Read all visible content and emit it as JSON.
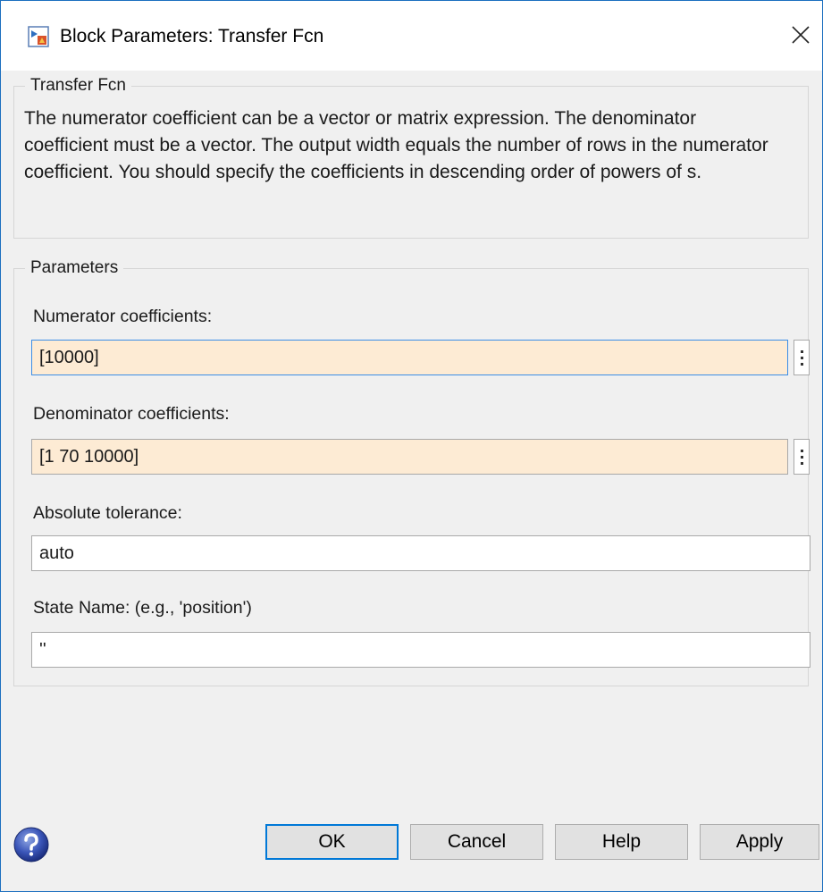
{
  "window": {
    "title": "Block Parameters: Transfer Fcn",
    "icon": "simulink-block-icon",
    "close_icon": "close-icon"
  },
  "block_group": {
    "legend": "Transfer Fcn",
    "description": "The numerator coefficient can be a vector or matrix expression. The denominator coefficient must be a vector. The output width equals the number of rows in the numerator coefficient. You should specify the coefficients in descending order of powers of s."
  },
  "params_group": {
    "legend": "Parameters",
    "fields": [
      {
        "label": "Numerator coefficients:",
        "value": "[10000]"
      },
      {
        "label": "Denominator coefficients:",
        "value": "[1 70 10000]"
      },
      {
        "label": "Absolute tolerance:",
        "value": "auto"
      },
      {
        "label": "State Name: (e.g., 'position')",
        "value": "''"
      }
    ]
  },
  "buttons": {
    "ok": "OK",
    "cancel": "Cancel",
    "help": "Help",
    "apply": "Apply"
  },
  "colors": {
    "accent": "#0078d7",
    "highlight_field": "#fdebd4",
    "dialog_bg": "#f0f0f0"
  }
}
